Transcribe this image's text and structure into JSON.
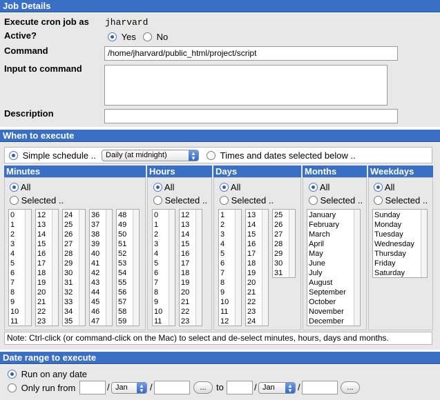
{
  "job_details": {
    "header": "Job Details",
    "execute_as_label": "Execute cron job as",
    "execute_as_value": "jharvard",
    "active_label": "Active?",
    "active_yes": "Yes",
    "active_no": "No",
    "active_selected": "Yes",
    "command_label": "Command",
    "command_value": "/home/jharvard/public_html/project/script",
    "input_label": "Input to command",
    "input_value": "",
    "description_label": "Description",
    "description_value": ""
  },
  "when": {
    "header": "When to execute",
    "simple_schedule_label": "Simple schedule ..",
    "simple_schedule_value": "Daily (at midnight)",
    "times_dates_label": "Times and dates selected below ..",
    "schedule_selected": "simple",
    "columns": {
      "minutes": {
        "title": "Minutes",
        "all": "All",
        "selected": "Selected .."
      },
      "hours": {
        "title": "Hours",
        "all": "All",
        "selected": "Selected .."
      },
      "days": {
        "title": "Days",
        "all": "All",
        "selected": "Selected .."
      },
      "months": {
        "title": "Months",
        "all": "All",
        "selected": "Selected .."
      },
      "weekdays": {
        "title": "Weekdays",
        "all": "All",
        "selected": "Selected .."
      }
    },
    "minutes_lists": [
      [
        "0",
        "1",
        "2",
        "3",
        "4",
        "5",
        "6",
        "7",
        "8",
        "9",
        "10",
        "11"
      ],
      [
        "12",
        "13",
        "14",
        "15",
        "16",
        "17",
        "18",
        "19",
        "20",
        "21",
        "22",
        "23"
      ],
      [
        "24",
        "25",
        "26",
        "27",
        "28",
        "29",
        "30",
        "31",
        "32",
        "33",
        "34",
        "35"
      ],
      [
        "36",
        "37",
        "38",
        "39",
        "40",
        "41",
        "42",
        "43",
        "44",
        "45",
        "46",
        "47"
      ],
      [
        "48",
        "49",
        "50",
        "51",
        "52",
        "53",
        "54",
        "55",
        "56",
        "57",
        "58",
        "59"
      ]
    ],
    "hours_lists": [
      [
        "0",
        "1",
        "2",
        "3",
        "4",
        "5",
        "6",
        "7",
        "8",
        "9",
        "10",
        "11"
      ],
      [
        "12",
        "13",
        "14",
        "15",
        "16",
        "17",
        "18",
        "19",
        "20",
        "21",
        "22",
        "23"
      ]
    ],
    "days_lists": [
      [
        "1",
        "2",
        "3",
        "4",
        "5",
        "6",
        "7",
        "8",
        "9",
        "10",
        "11",
        "12"
      ],
      [
        "13",
        "14",
        "15",
        "16",
        "17",
        "18",
        "19",
        "20",
        "21",
        "22",
        "23",
        "24"
      ],
      [
        "25",
        "26",
        "27",
        "28",
        "29",
        "30",
        "31"
      ]
    ],
    "months_list": [
      "January",
      "February",
      "March",
      "April",
      "May",
      "June",
      "July",
      "August",
      "September",
      "October",
      "November",
      "December"
    ],
    "weekdays_list": [
      "Sunday",
      "Monday",
      "Tuesday",
      "Wednesday",
      "Thursday",
      "Friday",
      "Saturday"
    ],
    "note": "Note: Ctrl-click (or command-click on the Mac) to select and de-select minutes, hours, days and months."
  },
  "date_range": {
    "header": "Date range to execute",
    "run_any_label": "Run on any date",
    "only_run_label": "Only run from",
    "from_month": "Jan",
    "to_label": "to",
    "to_month": "Jan",
    "browse_label": "...",
    "slash": "/",
    "selected": "any"
  }
}
